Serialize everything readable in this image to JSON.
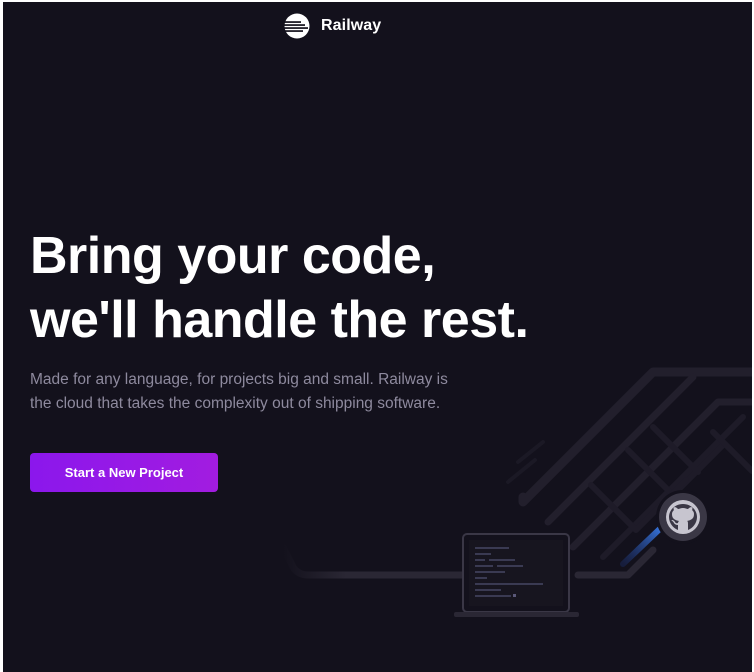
{
  "header": {
    "brand_name": "Railway",
    "logo_icon": "railway-logo-icon"
  },
  "hero": {
    "title_line1": "Bring your code,",
    "title_line2": "we'll handle the rest.",
    "subtitle_line1": "Made for any language, for projects big and small. Railway is",
    "subtitle_line2": "the cloud that takes the complexity out of shipping software.",
    "cta_label": "Start a New Project"
  },
  "illustration": {
    "icons": [
      "laptop-icon",
      "github-icon",
      "circuit-lines-decoration"
    ]
  },
  "colors": {
    "background": "#13111c",
    "accent": "#8b17ec",
    "text_primary": "#ffffff",
    "text_secondary": "#8e8a9e",
    "line_highlight": "#2f6fe4"
  }
}
